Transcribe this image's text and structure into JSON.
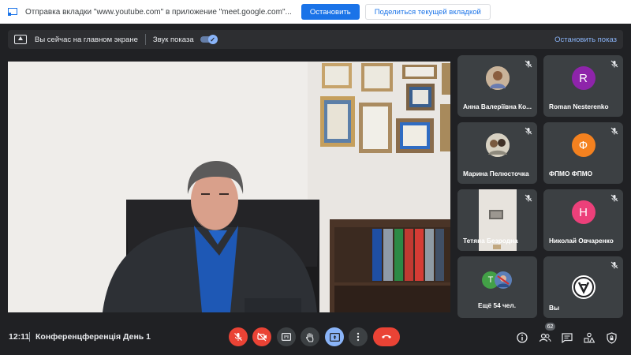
{
  "share_bar": {
    "message": "Отправка вкладки \"www.youtube.com\" в приложение \"meet.google.com\"...",
    "stop_label": "Остановить",
    "share_tab_label": "Поделиться текущей вкладкой"
  },
  "present_bar": {
    "status": "Вы сейчас на главном экране",
    "sound_label": "Звук показа",
    "sound_on": true,
    "stop_label": "Остановить показ"
  },
  "participants": [
    {
      "name": "Анна Валеріївна Ко...",
      "muted": true,
      "avatar_type": "photo"
    },
    {
      "name": "Roman Nesterenko",
      "muted": true,
      "avatar_letter": "R",
      "avatar_color": "#8e24aa"
    },
    {
      "name": "Марина Пелюсточка",
      "muted": true,
      "avatar_type": "photo"
    },
    {
      "name": "ФПМО ФПМО",
      "muted": true,
      "avatar_letter": "Ф",
      "avatar_color": "#f4811f"
    },
    {
      "name": "Тетяна Безродна",
      "muted": true,
      "avatar_type": "video"
    },
    {
      "name": "Николай Овчаренко",
      "muted": true,
      "avatar_letter": "Н",
      "avatar_color": "#ec407a"
    },
    {
      "name": "Ещё 54 чел.",
      "avatar_letter": "Т",
      "avatar_color": "#43a047"
    },
    {
      "name": "Вы",
      "muted": true,
      "avatar_type": "logo"
    }
  ],
  "bottom_bar": {
    "time": "12:11",
    "meeting_title": "Конференцференція День 1",
    "people_count": "62"
  },
  "colors": {
    "danger": "#ea4335",
    "accent": "#8ab4f8",
    "brand_blue": "#1a73e8"
  }
}
